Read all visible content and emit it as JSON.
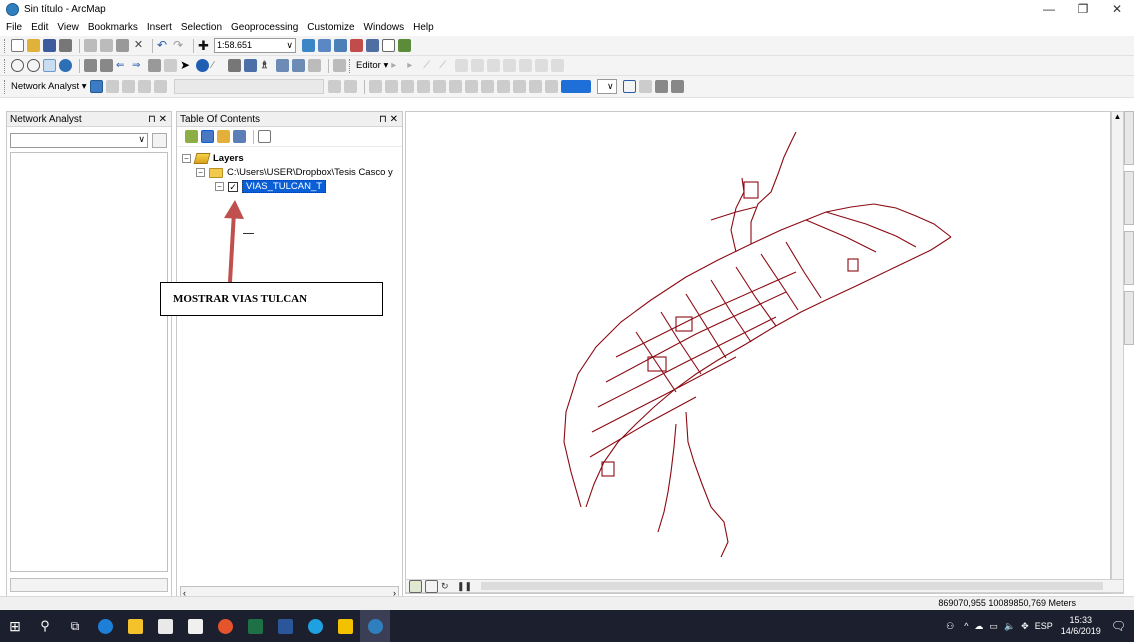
{
  "window": {
    "title": "Sin título - ArcMap",
    "controls": [
      "—",
      "❐",
      "✕"
    ]
  },
  "menu": [
    "File",
    "Edit",
    "View",
    "Bookmarks",
    "Insert",
    "Selection",
    "Geoprocessing",
    "Customize",
    "Windows",
    "Help"
  ],
  "toolbar": {
    "scale": "1:58.651",
    "editor_label": "Editor ▾",
    "network_analyst_label": "Network Analyst ▾"
  },
  "network_analyst_panel": {
    "title": "Network Analyst",
    "pin_close": "⊓ ✕"
  },
  "toc": {
    "title": "Table Of Contents",
    "pin_close": "⊓ ✕",
    "layers_label": "Layers",
    "folder_path": "C:\\Users\\USER\\Dropbox\\Tesis Casco y",
    "layer_name": "VIAS_TULCAN_T",
    "layer_checked": true
  },
  "callout": {
    "text": "MOSTRAR VIAS TULCAN"
  },
  "status": {
    "coordinates": "869070,955  10089850,769 Meters"
  },
  "taskbar": {
    "language": "ESP",
    "time": "15:33",
    "date": "14/6/2019"
  },
  "colors": {
    "road_color": "#8b0a12",
    "selection_color": "#0a5fd6",
    "taskbar_bg": "#1c1f2e",
    "callout_arrow": "#c0504d"
  }
}
